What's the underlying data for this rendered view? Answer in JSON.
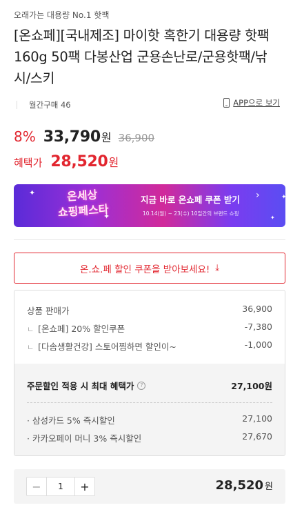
{
  "product": {
    "tagline": "오래가는 대용량 No.1 핫팩",
    "title": "[온쇼페][국내제조] 마이핫 혹한기 대용량 핫팩 160g 50팩 다봉산업 군용손난로/군용핫팩/낚시/스키",
    "monthly_purchases": "월간구매 46",
    "app_link": "APP으로 보기"
  },
  "pricing": {
    "discount": "8%",
    "price": "33,790",
    "currency": "원",
    "original_price": "36,900",
    "benefit_label": "혜택가",
    "benefit_price": "28,520"
  },
  "banner": {
    "logo_line1": "온세상",
    "logo_line2": "쇼핑페스타",
    "headline": "지금 바로 온쇼페 쿠폰 받기",
    "subtext": "10.14(월) ~ 23(수) 10일간의 브랜드 쇼핑"
  },
  "coupon_button": {
    "label": "온.쇼.페 할인 쿠폰을 받아보세요!",
    "icon": "download-icon"
  },
  "breakdown": {
    "sale_price_label": "상품 판매가",
    "sale_price_value": "36,900",
    "items": [
      {
        "label": "[온쇼페] 20% 할인쿠폰",
        "value": "-7,380"
      },
      {
        "label": "[다솜생활건강] 스토어찜하면 할인이~",
        "value": "-1,000"
      }
    ],
    "max_benefit_label": "주문할인 적용 시 최대 혜택가",
    "max_benefit_value": "27,100원",
    "cards": [
      {
        "label": "· 삼성카드 5% 즉시할인",
        "value": "27,100"
      },
      {
        "label": "· 카카오페이 머니 3% 즉시할인",
        "value": "27,670"
      }
    ]
  },
  "order": {
    "quantity": "1",
    "total_price": "28,520",
    "currency": "원"
  },
  "colors": {
    "accent_red": "#e2262f",
    "banner_gradient_start": "#5a2bd8",
    "banner_gradient_end": "#5b4df2"
  }
}
